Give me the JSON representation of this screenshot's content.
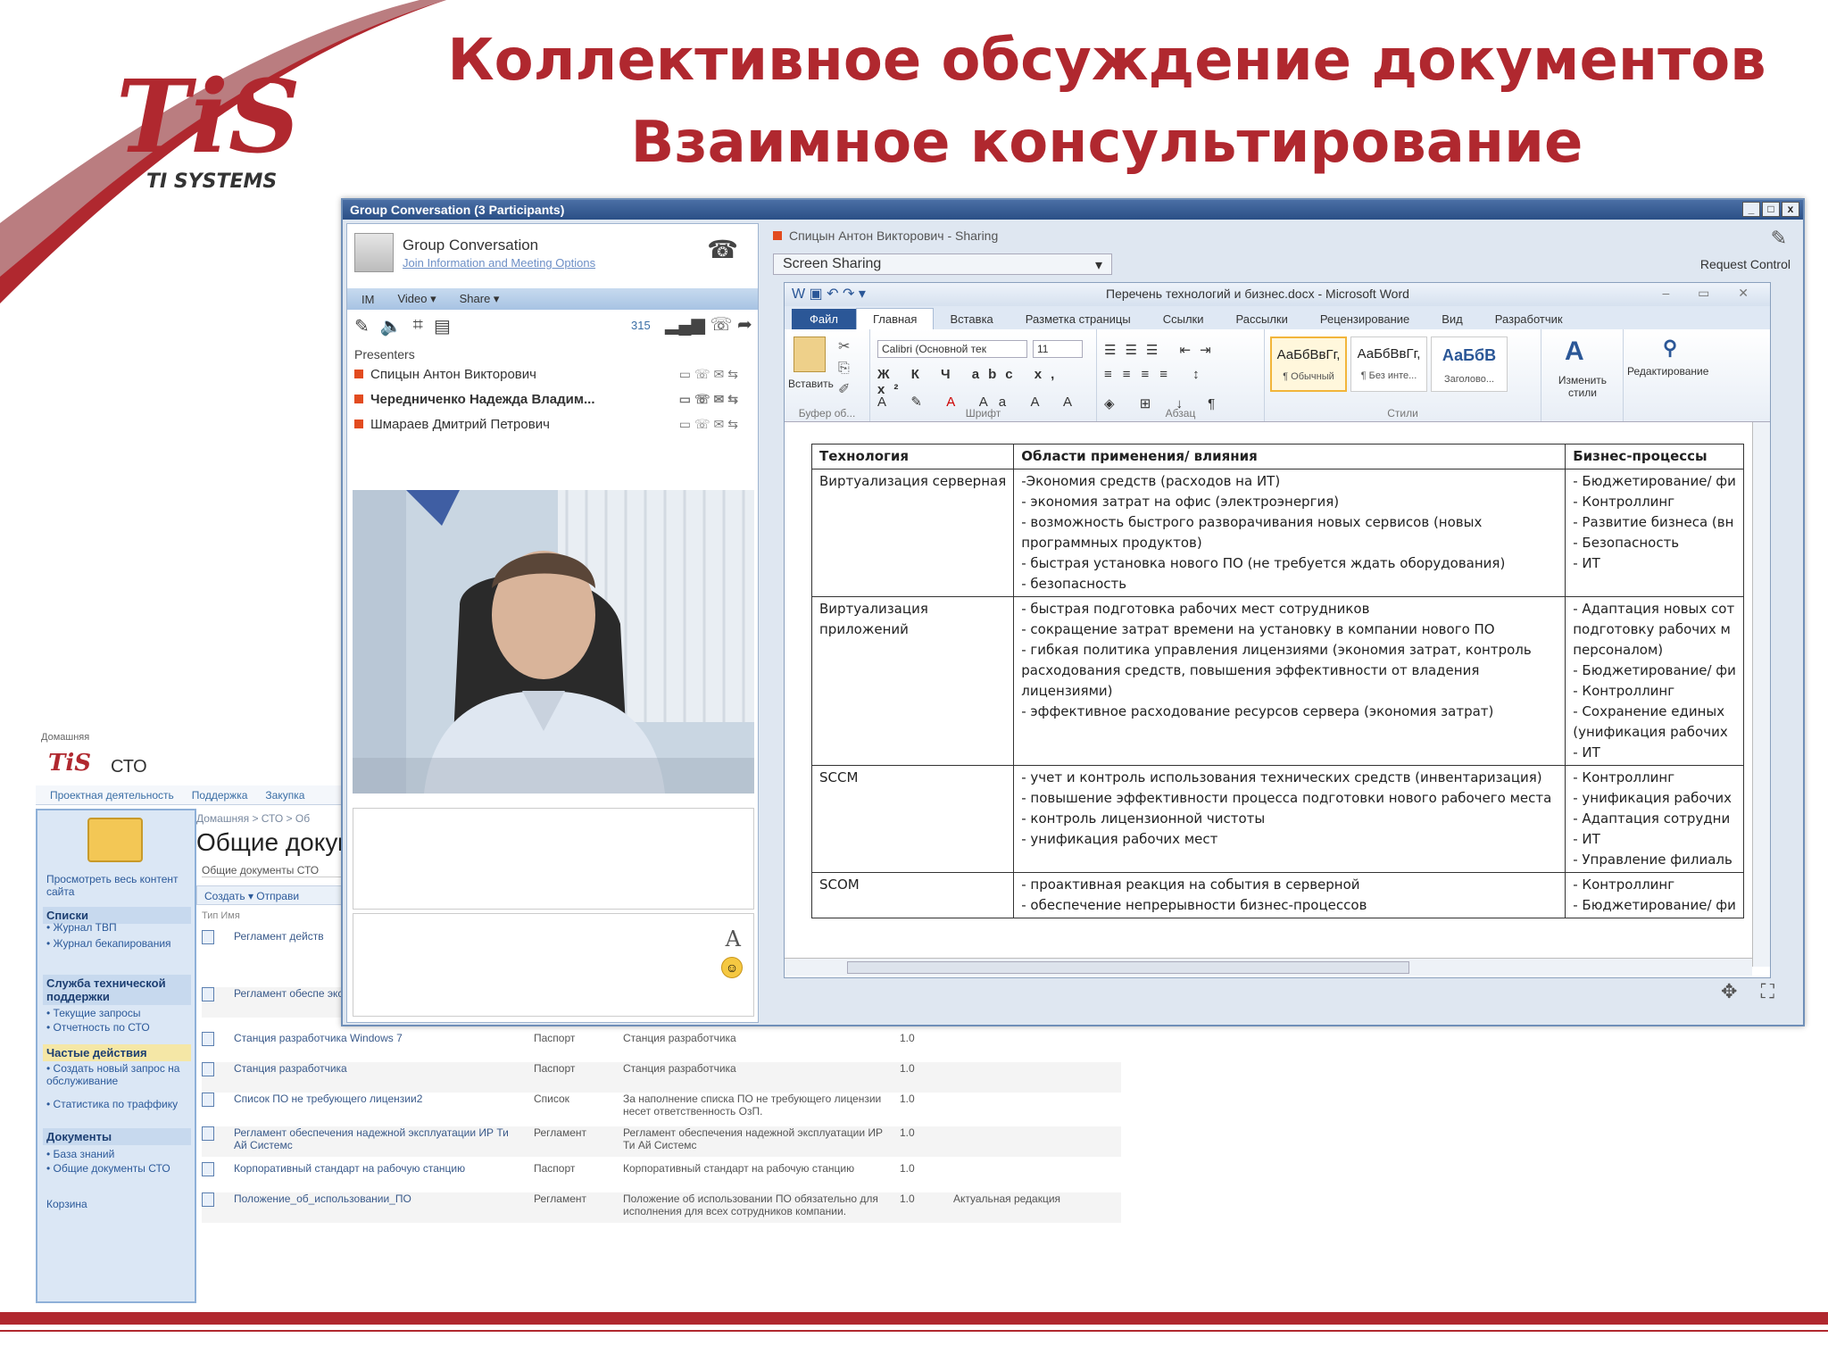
{
  "slide": {
    "title_line1": "Коллективное обсуждение документов",
    "title_line2": "Взаимное консультирование",
    "logo_text": "TiS",
    "logo_subtitle": "TI SYSTEMS",
    "accent": "#b0282f"
  },
  "lync": {
    "title": "Group Conversation (3 Participants)",
    "conv_name": "Group Conversation",
    "conv_link": "Join Information and Meeting Options",
    "modes": [
      "IM",
      "Video ▾",
      "Share ▾"
    ],
    "kbps": "315",
    "presenters_label": "Presenters",
    "presenters": [
      "Спицын Антон Викторович",
      "Чередниченко Надежда Владим...",
      "Шмараев Дмитрий Петрович"
    ],
    "sharing_from": "Спицын Антон Викторович",
    "sharing_suffix": " - Sharing",
    "screen_sharing": "Screen Sharing",
    "request_control": "Request Control"
  },
  "word": {
    "title": "Перечень технологий и бизнес.docx - Microsoft Word",
    "tabs": [
      "Файл",
      "Главная",
      "Вставка",
      "Разметка страницы",
      "Ссылки",
      "Рассылки",
      "Рецензирование",
      "Вид",
      "Разработчик"
    ],
    "groups": {
      "clipboard": "Буфер об...",
      "font": "Шрифт",
      "paragraph": "Абзац",
      "styles": "Стили",
      "paste": "Вставить",
      "change_styles": "Изменить стили",
      "editing": "Редактирование"
    },
    "font_name": "Calibri (Основной тек",
    "font_size": "11",
    "styles": [
      {
        "sample": "АаБбВвГг,",
        "name": "¶ Обычный"
      },
      {
        "sample": "АаБбВвГг,",
        "name": "¶ Без инте..."
      },
      {
        "sample": "АаБбВ",
        "name": "Заголово..."
      }
    ],
    "table": {
      "headers": [
        "Технология",
        "Области применения/ влияния",
        "Бизнес-процессы"
      ],
      "rows": [
        {
          "tech": [
            "Виртуализация серверная"
          ],
          "areas": [
            "-Экономия средств (расходов на ИТ)",
            "- экономия затрат на офис (электроэнергия)",
            "- возможность быстрого разворачивания новых сервисов (новых",
            "программных продуктов)",
            "- быстрая установка нового ПО (не требуется ждать оборудования)",
            "- безопасность"
          ],
          "processes": [
            "- Бюджетирование/ фи",
            "- Контроллинг",
            "- Развитие бизнеса (вн",
            "- Безопасность",
            "- ИТ"
          ]
        },
        {
          "tech": [
            "Виртуализация",
            "приложений"
          ],
          "areas": [
            "- быстрая подготовка рабочих мест сотрудников",
            "- сокращение затрат времени на установку в компании нового ПО",
            "- гибкая политика управления лицензиями (экономия затрат, контроль",
            "расходования средств, повышения эффективности от владения",
            "лицензиями)",
            "-  эффективное расходование ресурсов сервера (экономия затрат)"
          ],
          "processes": [
            "- Адаптация новых сот",
            "подготовку рабочих м",
            "персоналом)",
            "- Бюджетирование/ фи",
            "- Контроллинг",
            "- Сохранение единых",
            "(унификация рабочих",
            "- ИТ"
          ]
        },
        {
          "tech": [
            "SCCM"
          ],
          "areas": [
            "- учет и контроль использования технических средств (инвентаризация)",
            "- повышение эффективности процесса подготовки нового рабочего места",
            "- контроль лицензионной чистоты",
            "- унификация рабочих мест"
          ],
          "processes": [
            "- Контроллинг",
            "- унификация рабочих",
            "- Адаптация сотрудни",
            "- ИТ",
            "- Управление филиаль"
          ]
        },
        {
          "tech": [
            "SCOM"
          ],
          "areas": [
            "- проактивная реакция на события в серверной",
            "- обеспечение непрерывности бизнес-процессов"
          ],
          "processes": [
            "- Контроллинг",
            "- Бюджетирование/ фи"
          ]
        }
      ]
    }
  },
  "sharepoint": {
    "top": "Домашняя",
    "logo": "TiS",
    "site": "СТО",
    "nav": [
      "Проектная деятельность",
      "Поддержка",
      "Закупка"
    ],
    "crumb": "Домашняя > СТО > Об",
    "heading": "Общие докум",
    "subheading": "Общие документы СТО",
    "toolbar": "Создать  ▾   Отправи",
    "cols": "Тип    Имя",
    "left_links": [
      {
        "kind": "link",
        "text": "Просмотреть весь контент сайта"
      },
      {
        "kind": "head",
        "text": "Списки"
      },
      {
        "kind": "link",
        "text": "• Журнал ТВП"
      },
      {
        "kind": "link",
        "text": "• Журнал бекапирования"
      },
      {
        "kind": "head",
        "text": "Служба технической поддержки"
      },
      {
        "kind": "link",
        "text": "• Текущие запросы"
      },
      {
        "kind": "link",
        "text": "• Отчетность по СТО"
      },
      {
        "kind": "headyel",
        "text": "Частые действия"
      },
      {
        "kind": "link",
        "text": "• Создать новый запрос на обслуживание"
      },
      {
        "kind": "link",
        "text": "• Статистика по траффику"
      },
      {
        "kind": "head",
        "text": "Документы"
      },
      {
        "kind": "link",
        "text": "• База знаний"
      },
      {
        "kind": "link",
        "text": "• Общие документы СТО"
      },
      {
        "kind": "link",
        "text": "Корзина"
      }
    ],
    "rows": [
      {
        "name": "Регламент действ",
        "type": "",
        "desc": "",
        "ver": "",
        "status": ""
      },
      {
        "name": "Регламент обеспе эксплуатации ИР Т",
        "type": "",
        "desc": "",
        "ver": "",
        "status": ""
      },
      {
        "name": "Станция разработчика Windows 7",
        "type": "Паспорт",
        "desc": "Станция разработчика",
        "ver": "1.0",
        "status": ""
      },
      {
        "name": "Станция разработчика",
        "type": "Паспорт",
        "desc": "Станция разработчика",
        "ver": "1.0",
        "status": ""
      },
      {
        "name": "Список ПО не требующего лицензии2",
        "type": "Список",
        "desc": "За наполнение списка ПО не требующего лицензии несет ответственность ОзП.",
        "ver": "1.0",
        "status": ""
      },
      {
        "name": "Регламент обеспечения надежной эксплуатации ИР Ти Ай Системс",
        "type": "Регламент",
        "desc": "Регламент обеспечения надежной эксплуатации ИР Ти Ай Системс",
        "ver": "1.0",
        "status": ""
      },
      {
        "name": "Корпоративный стандарт на рабочую станцию",
        "type": "Паспорт",
        "desc": "Корпоративный стандарт на рабочую станцию",
        "ver": "1.0",
        "status": ""
      },
      {
        "name": "Положение_об_использовании_ПО",
        "type": "Регламент",
        "desc": "Положение об использовании ПО обязательно для исполнения для всех сотрудников компании.",
        "ver": "1.0",
        "status": "Актуальная редакция"
      }
    ]
  }
}
